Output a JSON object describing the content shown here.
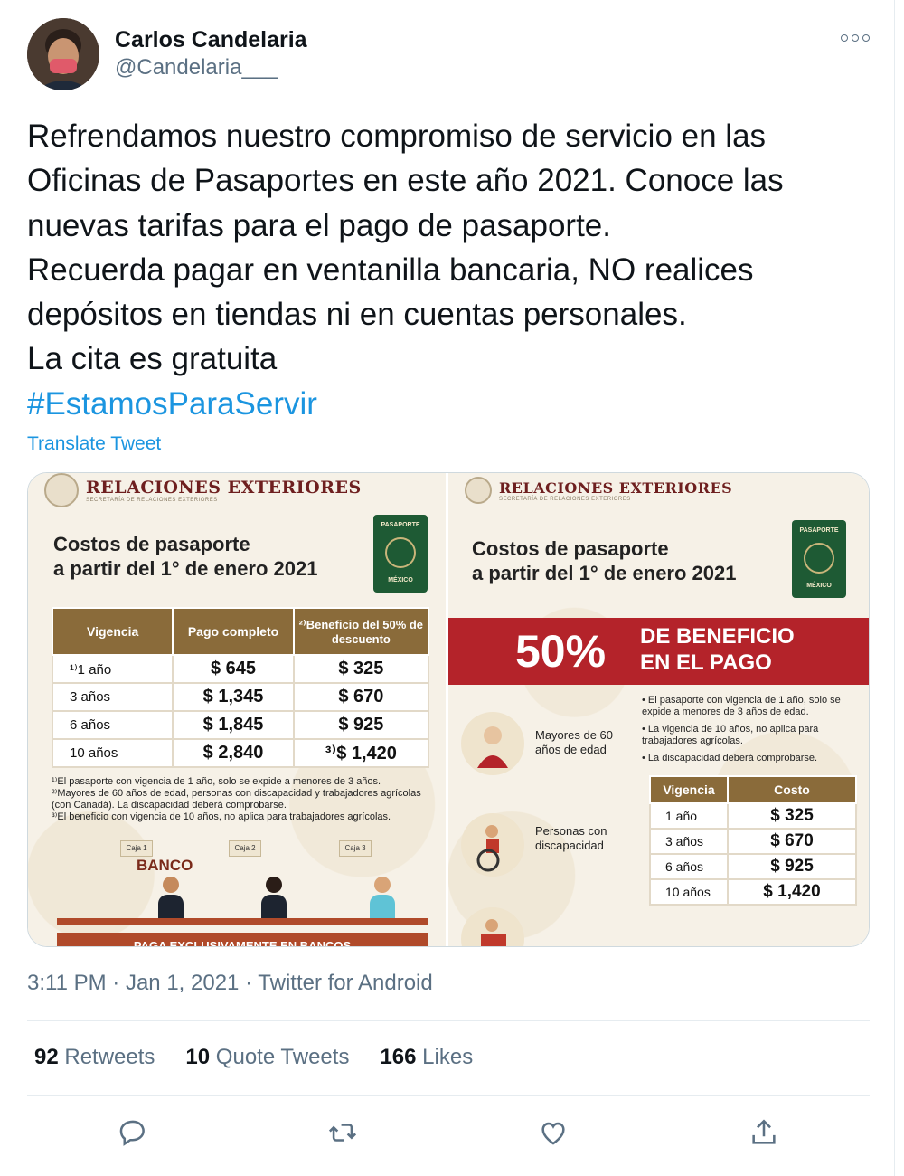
{
  "author": {
    "name": "Carlos Candelaria",
    "handle": "@Candelaria___"
  },
  "icons": {
    "more": "more-options-icon",
    "reply": "reply-icon",
    "retweet": "retweet-icon",
    "like": "heart-icon",
    "share": "share-icon"
  },
  "colors": {
    "accent": "#1b95e0",
    "text_secondary": "#5b7083",
    "band_red": "#b4232a",
    "table_header": "#8a6b3a"
  },
  "tweet": {
    "lines": [
      "Refrendamos nuestro compromiso de servicio en las",
      "Oficinas de Pasaportes en este año 2021. Conoce las",
      "nuevas tarifas para el pago de pasaporte.",
      "Recuerda pagar en ventanilla bancaria, NO realices",
      "depósitos en tiendas ni en cuentas personales.",
      "La cita es gratuita"
    ],
    "hashtag": "#EstamosParaServir",
    "translate_label": "Translate Tweet"
  },
  "media": {
    "left": {
      "org": "RELACIONES EXTERIORES",
      "org_sub": "SECRETARÍA DE RELACIONES EXTERIORES",
      "title_line1": "Costos de pasaporte",
      "title_line2": "a partir del 1° de enero 2021",
      "passport_top": "PASAPORTE",
      "passport_bottom": "MÉXICO",
      "headers": [
        "Vigencia",
        "Pago completo",
        "²⁾Beneficio del 50% de descuento"
      ],
      "rows": [
        [
          "¹⁾1 año",
          "$ 645",
          "$ 325"
        ],
        [
          "3 años",
          "$ 1,345",
          "$ 670"
        ],
        [
          "6 años",
          "$ 1,845",
          "$ 925"
        ],
        [
          "10 años",
          "$ 2,840",
          "³⁾$ 1,420"
        ]
      ],
      "notes": [
        "¹⁾El pasaporte con vigencia de 1 año, solo se expide a menores de 3 años.",
        "²⁾Mayores de 60 años de edad, personas con discapacidad y trabajadores agrícolas (con Canadá). La discapacidad deberá comprobarse.",
        "³⁾El beneficio con vigencia de 10 años, no aplica para trabajadores agrícolas."
      ],
      "bank_label": "BANCO",
      "cajas": [
        "Caja 1",
        "Caja 2",
        "Caja 3"
      ],
      "pay_label": "PAGA EXCLUSIVAMENTE EN BANCOS"
    },
    "right": {
      "org": "RELACIONES EXTERIORES",
      "org_sub": "SECRETARÍA DE RELACIONES EXTERIORES",
      "title_line1": "Costos de pasaporte",
      "title_line2": "a partir del 1° de enero 2021",
      "passport_top": "PASAPORTE",
      "passport_bottom": "MÉXICO",
      "benefit_pct": "50%",
      "benefit_line1": "DE BENEFICIO",
      "benefit_line2": "EN EL PAGO",
      "bullets": [
        "El pasaporte con vigencia de 1 año, solo se expide a menores de 3 años de edad.",
        "La vigencia de 10 años, no aplica para trabajadores agrícolas.",
        "La discapacidad deberá comprobarse."
      ],
      "groups": [
        "Mayores de 60\naños de edad",
        "Personas con\ndiscapacidad"
      ],
      "headers": [
        "Vigencia",
        "Costo"
      ],
      "rows": [
        [
          "1 año",
          "$ 325"
        ],
        [
          "3 años",
          "$ 670"
        ],
        [
          "6 años",
          "$ 925"
        ],
        [
          "10 años",
          "$ 1,420"
        ]
      ]
    }
  },
  "meta": {
    "time": "3:11 PM",
    "date": "Jan 1, 2021",
    "source": "Twitter for Android"
  },
  "stats": {
    "retweets_count": "92",
    "retweets_label": "Retweets",
    "quotes_count": "10",
    "quotes_label": "Quote Tweets",
    "likes_count": "166",
    "likes_label": "Likes"
  }
}
